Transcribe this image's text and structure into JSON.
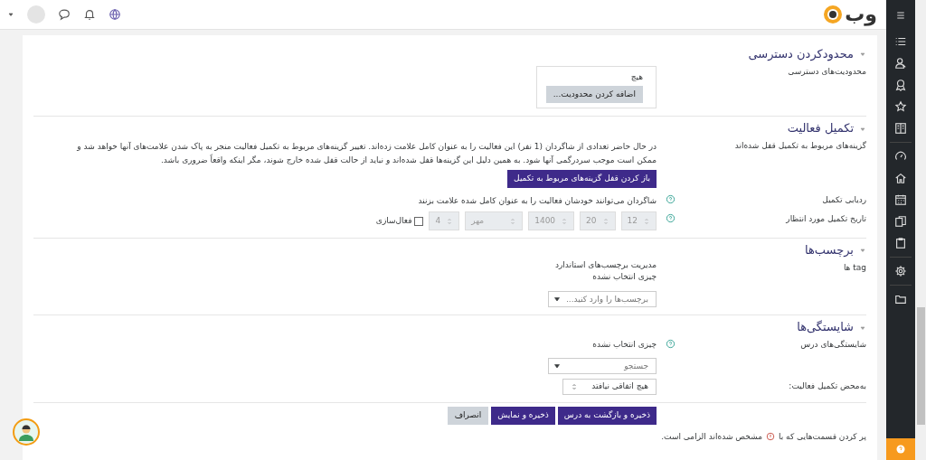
{
  "header": {
    "logo": "وب"
  },
  "sections": [
    {
      "title": "محدودکردن دسترسی",
      "expanded": true,
      "rows": [
        {
          "kind": "restrict",
          "label": "محدودیت‌های دسترسی",
          "help": false,
          "text": "هیچ",
          "button": "اضافه کردن محدودیت..."
        }
      ]
    },
    {
      "title": "تکمیل فعالیت",
      "expanded": true,
      "rows": [
        {
          "kind": "notice",
          "label": "گزینه‌های مربوط به تکمیل قفل شده‌اند",
          "help": false,
          "text": "در حال حاضر تعدادی از شاگردان (1 نفر) این فعالیت را به عنوان کامل علامت زده‌اند. تغییر گزینه‌های مربوط به تکمیل فعالیت منجر به پاک شدن علامت‌های آنها خواهد شد و ممکن است موجب سردرگمی آنها شود. به همین دلیل این گزینه‌ها قفل شده‌اند و نباید از حالت قفل شده خارج شوند، مگر اینکه واقعاً ضروری باشد.",
          "button": "باز کردن قفل گزینه‌های مربوط به تکمیل"
        },
        {
          "kind": "text",
          "label": "ردیابی تکمیل",
          "help": true,
          "text": "شاگردان می‌توانند خودشان فعالیت را به عنوان کامل شده علامت بزنند"
        },
        {
          "kind": "date",
          "label": "تاریخ تکمیل مورد انتظار",
          "help": true,
          "selects": [
            {
              "value": "12",
              "disabled": true
            },
            {
              "value": "20",
              "disabled": true
            },
            {
              "value": "1400",
              "disabled": true
            },
            {
              "value": "مهر",
              "disabled": true
            },
            {
              "value": "4",
              "disabled": true
            }
          ],
          "checkbox": {
            "label": "فعال‌سازی",
            "checked": false
          }
        }
      ]
    },
    {
      "title": "برچسب‌ها",
      "expanded": true,
      "rows": [
        {
          "kind": "tags",
          "label": "tag ها",
          "help": false,
          "texts": [
            "مدیریت برچسب‌های استاندارد",
            "چیزی انتخاب نشده"
          ],
          "placeholder": "برچسب‌ها را وارد کنید..."
        }
      ]
    },
    {
      "title": "شایستگی‌ها",
      "expanded": true,
      "rows": [
        {
          "kind": "search",
          "label": "شایستگی‌های درس",
          "help": true,
          "text": "چیزی انتخاب نشده",
          "placeholder": "جستجو"
        },
        {
          "kind": "select",
          "label": "به‌محض تکمیل فعالیت:",
          "help": false,
          "value": "هیچ اتفاقی نیافتد"
        }
      ]
    }
  ],
  "buttons": [
    {
      "label": "ذخیره و بازگشت به درس",
      "kind": "primary"
    },
    {
      "label": "ذخیره و نمایش",
      "kind": "primary"
    },
    {
      "label": "انصراف",
      "kind": "secondary"
    }
  ],
  "footnote": {
    "before": "پر کردن قسمت‌هایی که با",
    "after": "مشخص شده‌اند الزامی است."
  }
}
